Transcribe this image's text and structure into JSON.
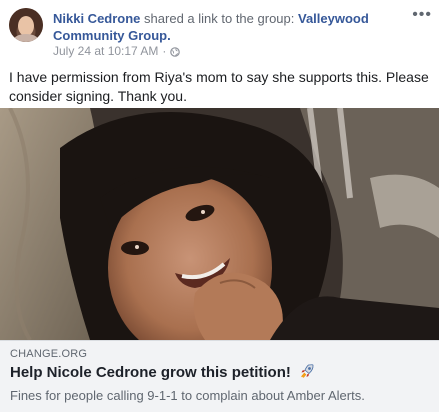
{
  "post": {
    "author": "Nikki Cedrone",
    "action_text": "shared a link to the group:",
    "group_name": "Valleywood Community Group.",
    "timestamp": "July 24 at 10:17 AM",
    "separator": "·",
    "privacy_icon": "globe-icon",
    "more_icon": "more-options-icon",
    "more_glyph": "•••",
    "body": "I have permission from Riya's mom to say she supports this. Please consider signing. Thank you."
  },
  "link_preview": {
    "domain": "CHANGE.ORG",
    "title": "Help Nicole Cedrone grow this petition!",
    "title_icon": "rocket-icon",
    "description": "Fines for people calling 9-1-1 to complain about Amber Alerts."
  },
  "colors": {
    "link_blue": "#365899",
    "meta_gray": "#90949c",
    "card_bg": "#f2f3f5"
  }
}
